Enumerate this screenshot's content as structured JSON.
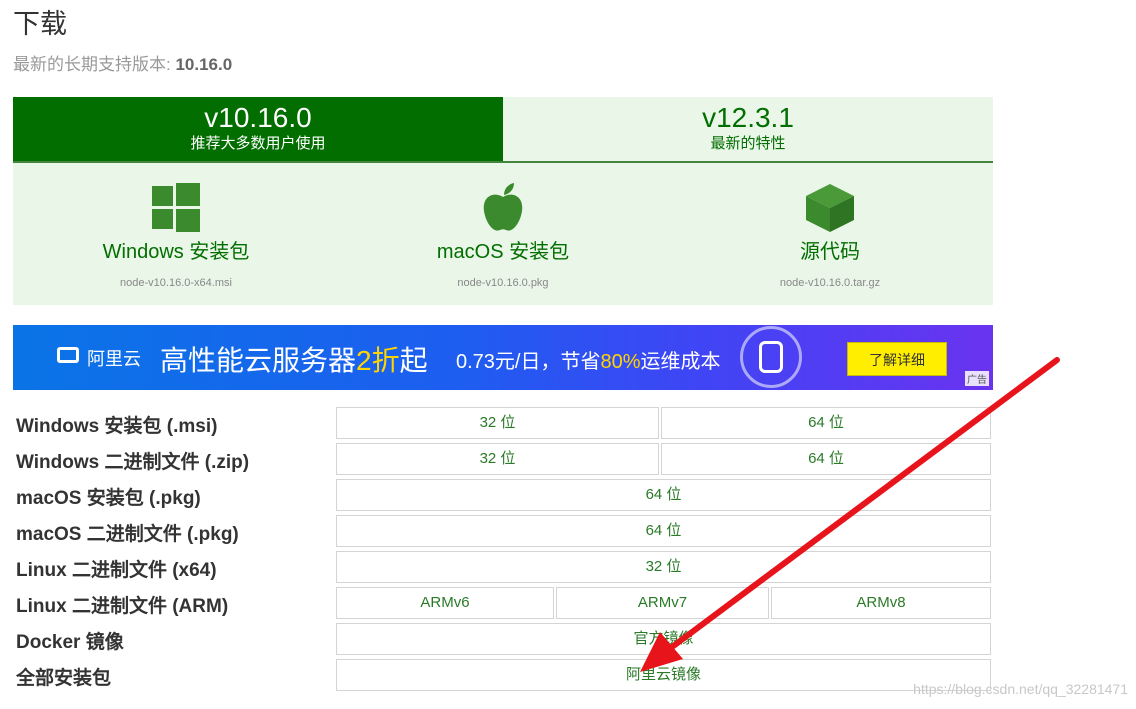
{
  "header": {
    "title": "下载",
    "lts_label": "最新的长期支持版本: ",
    "lts_version": "10.16.0"
  },
  "tabs": [
    {
      "version": "v10.16.0",
      "subtitle": "推荐大多数用户使用"
    },
    {
      "version": "v12.3.1",
      "subtitle": "最新的特性"
    }
  ],
  "downloads": [
    {
      "label": "Windows 安装包",
      "file": "node-v10.16.0-x64.msi",
      "icon": "windows-icon"
    },
    {
      "label": "macOS 安装包",
      "file": "node-v10.16.0.pkg",
      "icon": "apple-icon"
    },
    {
      "label": "源代码",
      "file": "node-v10.16.0.tar.gz",
      "icon": "cube-icon"
    }
  ],
  "ad": {
    "logo": "阿里云",
    "headline_a": "高性能云服务器",
    "headline_b": "2折",
    "headline_c": "起",
    "promo_a": "0.73元/日，节省",
    "promo_b": "80%",
    "promo_c": "运维成本",
    "cta": "了解详细",
    "tag": "广告"
  },
  "table": {
    "rows": [
      {
        "label": "Windows 安装包 (.msi)",
        "cells": [
          "32 位",
          "64 位"
        ]
      },
      {
        "label": "Windows 二进制文件 (.zip)",
        "cells": [
          "32 位",
          "64 位"
        ]
      },
      {
        "label": "macOS 安装包 (.pkg)",
        "cells": [
          "64 位"
        ]
      },
      {
        "label": "macOS 二进制文件 (.pkg)",
        "cells": [
          "64 位"
        ]
      },
      {
        "label": "Linux 二进制文件 (x64)",
        "cells": [
          "32 位"
        ]
      },
      {
        "label": "Linux 二进制文件 (ARM)",
        "cells": [
          "ARMv6",
          "ARMv7",
          "ARMv8"
        ]
      },
      {
        "label": "Docker 镜像",
        "cells": [
          "官方镜像"
        ]
      },
      {
        "label": "全部安装包",
        "cells": [
          "阿里云镜像"
        ]
      }
    ]
  },
  "watermark": "https://blog.csdn.net/qq_32281471",
  "colors": {
    "brand_dark": "#026e00",
    "brand_light": "#e9f6e8",
    "arrow": "#e8141c"
  }
}
